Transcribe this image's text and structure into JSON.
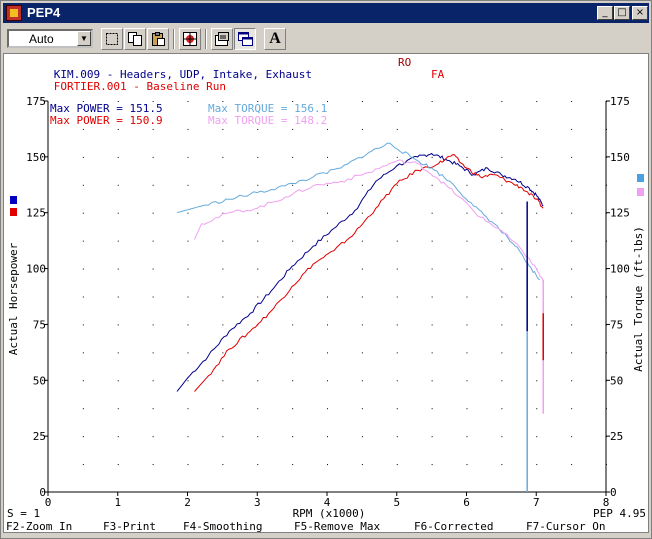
{
  "window": {
    "title": "PEP4"
  },
  "toolbar": {
    "combo_value": "Auto",
    "text_tool_label": "A"
  },
  "runs": [
    {
      "name": "KIM.009 - Headers, UDP, Intake, Exhaust",
      "tag": "RO",
      "color": "#00008b",
      "tag_color": "#a00000"
    },
    {
      "name": "FORTIER.001 - Baseline Run",
      "tag": "FA",
      "color": "#e00000",
      "tag_color": "#e00000"
    }
  ],
  "maxima": [
    {
      "power": "Max POWER = 151.5",
      "torque": "Max TORQUE = 156.1",
      "power_color": "#00008b",
      "torque_color": "#64aadc"
    },
    {
      "power": "Max POWER = 150.9",
      "torque": "Max TORQUE = 148.2",
      "power_color": "#e00000",
      "torque_color": "#f0a0f0"
    }
  ],
  "status": {
    "smoothing": "S = 1",
    "version": "PEP 4.95"
  },
  "function_keys": [
    "F2-Zoom In",
    "F3-Print",
    "F4-Smoothing",
    "F5-Remove Max",
    "F6-Corrected",
    "F7-Cursor On"
  ],
  "chart_data": {
    "type": "line",
    "xlabel": "RPM (x1000)",
    "ylabel_left": "Actual Horsepower",
    "ylabel_right": "Actual Torque (ft-lbs)",
    "x_ticks": [
      "0",
      "1",
      "2",
      "3",
      "4",
      "5",
      "6",
      "7",
      "8"
    ],
    "y_ticks": [
      "0",
      "25",
      "50",
      "75",
      "100",
      "125",
      "150",
      "175"
    ],
    "xlim": [
      0,
      8
    ],
    "ylim": [
      0,
      175
    ],
    "grid": "dotted",
    "series": [
      {
        "name": "KIM.009 Power",
        "color": "#00008b",
        "x": [
          1.85,
          2.0,
          2.3,
          2.6,
          2.9,
          3.2,
          3.5,
          3.8,
          4.1,
          4.4,
          4.7,
          5.0,
          5.3,
          5.5,
          5.7,
          5.9,
          6.1,
          6.3,
          6.5,
          6.7,
          6.9,
          7.0,
          7.1
        ],
        "y": [
          45,
          51,
          61,
          72,
          80,
          90,
          101,
          110,
          118,
          126,
          139,
          146,
          150,
          151.5,
          149,
          146,
          142,
          145,
          142,
          140,
          136,
          133,
          128
        ]
      },
      {
        "name": "FORTIER.001 Power",
        "color": "#e00000",
        "x": [
          2.1,
          2.3,
          2.6,
          2.9,
          3.2,
          3.5,
          3.8,
          4.1,
          4.4,
          4.7,
          5.0,
          5.3,
          5.6,
          5.8,
          6.0,
          6.2,
          6.4,
          6.6,
          6.8,
          7.0,
          7.1
        ],
        "y": [
          45,
          52,
          64,
          72,
          81,
          92,
          102,
          108,
          116,
          127,
          138,
          144,
          147,
          150.9,
          145,
          141,
          142,
          139,
          136,
          131,
          127
        ]
      },
      {
        "name": "KIM.009 Torque",
        "color": "#64aadc",
        "x": [
          1.85,
          2.2,
          2.6,
          3.0,
          3.4,
          3.8,
          4.2,
          4.6,
          4.9,
          5.2,
          5.5,
          5.8,
          6.1,
          6.4,
          6.7,
          6.9,
          7.05
        ],
        "y": [
          125,
          128,
          131,
          134,
          137,
          141,
          145,
          152,
          156.1,
          150,
          145,
          138,
          128,
          120,
          110,
          101,
          95
        ]
      },
      {
        "name": "FORTIER.001 Torque",
        "color": "#f0a0f0",
        "x": [
          2.1,
          2.2,
          2.6,
          3.0,
          3.4,
          3.8,
          4.2,
          4.6,
          5.0,
          5.3,
          5.6,
          5.9,
          6.2,
          6.5,
          6.8,
          7.0,
          7.1
        ],
        "y": [
          113,
          120,
          125,
          127,
          132,
          137,
          139,
          143,
          148.2,
          147,
          140,
          132,
          123,
          117,
          108,
          100,
          94
        ]
      }
    ],
    "drops": [
      {
        "series": "KIM.009 Torque",
        "x": 6.87,
        "y_from": 100,
        "y_to": 0
      },
      {
        "series": "KIM.009 Power",
        "x": 6.87,
        "y_from": 130,
        "y_to": 72
      },
      {
        "series": "FORTIER.001 Torque",
        "x": 7.1,
        "y_from": 95,
        "y_to": 35
      },
      {
        "series": "FORTIER.001 Power",
        "x": 7.1,
        "y_from": 80,
        "y_to": 59
      }
    ],
    "legend_markers": [
      {
        "side": "left",
        "series": "KIM.009 Power",
        "color": "#0000c0"
      },
      {
        "side": "left",
        "series": "FORTIER.001 Power",
        "color": "#e00000"
      },
      {
        "side": "right",
        "series": "KIM.009 Torque",
        "color": "#4aa0e0"
      },
      {
        "side": "right",
        "series": "FORTIER.001 Torque",
        "color": "#f0a0f0"
      }
    ]
  }
}
